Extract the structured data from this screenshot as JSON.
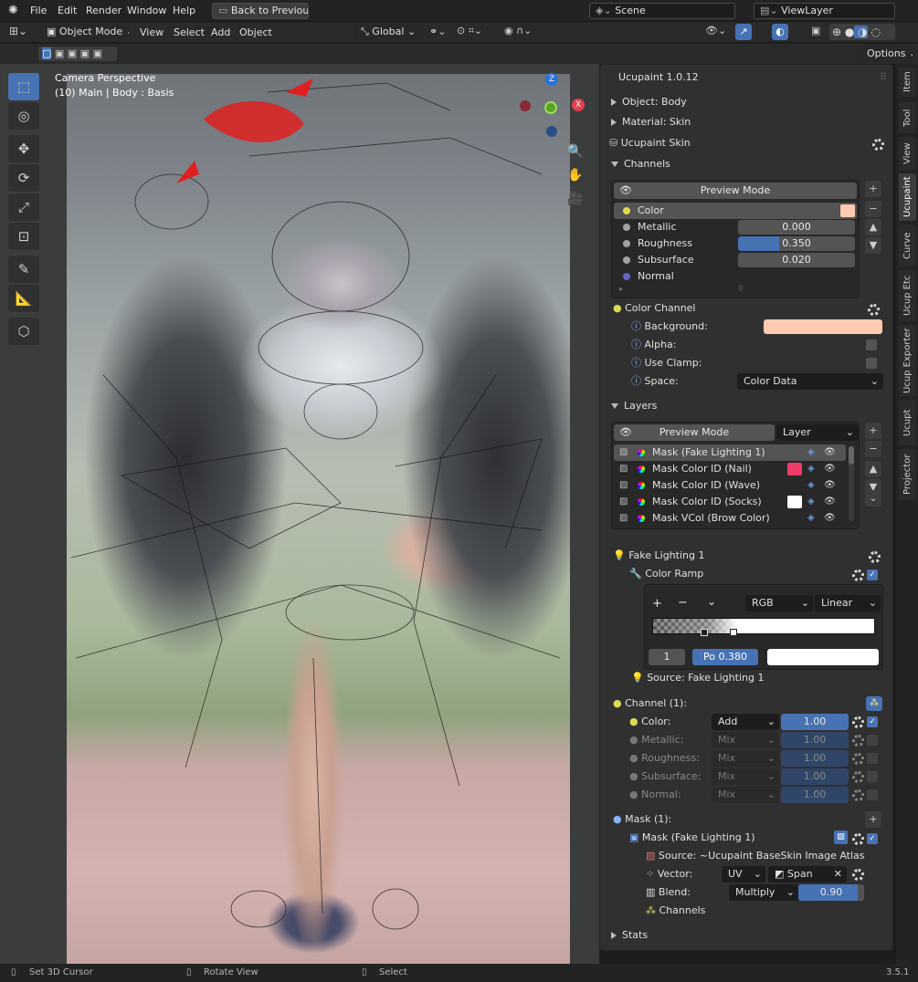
{
  "menubar": {
    "items": [
      "File",
      "Edit",
      "Render",
      "Window",
      "Help"
    ],
    "back_button": "Back to Previous",
    "scene": "Scene",
    "view_layer": "ViewLayer"
  },
  "header": {
    "mode": "Object Mode",
    "view": "View",
    "select": "Select",
    "add": "Add",
    "object": "Object",
    "transform_orientation": "Global",
    "options": "Options"
  },
  "viewport": {
    "title": "Camera Perspective",
    "subtitle": "(10) Main | Body : Basis",
    "gizmo": {
      "z": "Z",
      "x": "X"
    }
  },
  "panel": {
    "title": "Ucupaint 1.0.12",
    "object_label": "Object: Body",
    "material_label": "Material: Skin",
    "ucupaint_label": "Ucupaint Skin",
    "channels_header": "Channels",
    "preview_mode": "Preview Mode",
    "channels": [
      {
        "name": "Color",
        "value": "",
        "swatch": "#ffcbb0",
        "dot": "#dcdc52"
      },
      {
        "name": "Metallic",
        "value": "0.000",
        "dot": "#a1a1a1"
      },
      {
        "name": "Roughness",
        "value": "0.350",
        "fill": 0.35,
        "dot": "#a1a1a1"
      },
      {
        "name": "Subsurface",
        "value": "0.020",
        "dot": "#a1a1a1"
      },
      {
        "name": "Normal",
        "value": "",
        "dot": "#6363c7"
      }
    ],
    "color_channel": "Color Channel",
    "background_label": "Background:",
    "background_color": "#ffcbb0",
    "alpha_label": "Alpha:",
    "use_clamp_label": "Use Clamp:",
    "space_label": "Space:",
    "space_value": "Color Data",
    "layers_header": "Layers",
    "layer_preview": "Preview Mode",
    "layer_dropdown": "Layer",
    "layers": [
      {
        "name": "Mask (Fake Lighting 1)",
        "color": ""
      },
      {
        "name": "Mask Color ID (Nail)",
        "color": "#ef3c6a"
      },
      {
        "name": "Mask Color ID (Wave)",
        "color": ""
      },
      {
        "name": "Mask Color ID (Socks)",
        "color": "#ffffff"
      },
      {
        "name": "Mask VCol (Brow Color)",
        "color": ""
      }
    ],
    "fake_lighting": "Fake Lighting 1",
    "color_ramp": "Color Ramp",
    "ramp_mode": "RGB",
    "ramp_interp": "Linear",
    "ramp_index": "1",
    "ramp_pos_label": "Po",
    "ramp_pos": "0.380",
    "ramp_color": "#ffffff",
    "ramp_symbols": [
      "+",
      "−",
      "⌄"
    ],
    "source_fake": "Source: Fake Lighting 1",
    "channel_count": "Channel (1):",
    "blend_rows": [
      {
        "label": "Color:",
        "blend": "Add",
        "value": "1.00",
        "active": true
      },
      {
        "label": "Metallic:",
        "blend": "Mix",
        "value": "1.00",
        "active": false
      },
      {
        "label": "Roughness:",
        "blend": "Mix",
        "value": "1.00",
        "active": false
      },
      {
        "label": "Subsurface:",
        "blend": "Mix",
        "value": "1.00",
        "active": false
      },
      {
        "label": "Normal:",
        "blend": "Mix",
        "value": "1.00",
        "active": false
      }
    ],
    "mask_count": "Mask (1):",
    "mask_name": "Mask (Fake Lighting 1)",
    "mask_source": "Source: ~Ucupaint BaseSkin Image Atlas",
    "vector_label": "Vector:",
    "vector_value": "UV",
    "span_value": "Span",
    "blend_label": "Blend:",
    "blend_value": "Multiply",
    "blend_amount": "0.90",
    "channels_label": "Channels",
    "stats": "Stats"
  },
  "sidebar_tabs": [
    "Item",
    "Tool",
    "View",
    "Ucupaint",
    "Curve",
    "Ucup Etc",
    "Ucup Exporter",
    "Ucupt",
    "Projector"
  ],
  "status": {
    "left": "Set 3D Cursor",
    "middle": "Rotate View",
    "right": "Select",
    "version": "3.5.1"
  },
  "icons": [
    "blender-icon",
    "move-icon",
    "rotate-icon",
    "scale-icon",
    "transform-icon",
    "annotate-icon",
    "measure-icon",
    "add-cube-icon",
    "eye-icon",
    "gear-icon",
    "zoom-icon",
    "hand-icon",
    "camera-icon"
  ]
}
